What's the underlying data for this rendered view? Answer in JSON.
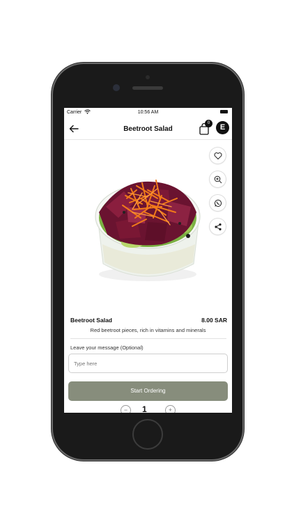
{
  "status_bar": {
    "carrier": "Carrier",
    "time": "10:56 AM"
  },
  "navbar": {
    "title": "Beetroot Salad",
    "cart_count": "0",
    "profile_initial": "E"
  },
  "product": {
    "name": "Beetroot Salad",
    "price": "8.00 SAR",
    "description": "Red beetroot pieces, rich in vitamins and minerals"
  },
  "actions": {
    "icons": [
      "heart-icon",
      "zoom-in-icon",
      "whatsapp-icon",
      "share-icon"
    ]
  },
  "message": {
    "label": "Leave your message (Optional)",
    "placeholder": "Type here"
  },
  "order": {
    "button_label": "Start Ordering",
    "quantity": "1",
    "minus": "−",
    "plus": "+"
  },
  "colors": {
    "button": "#878d7c",
    "text": "#111111"
  }
}
